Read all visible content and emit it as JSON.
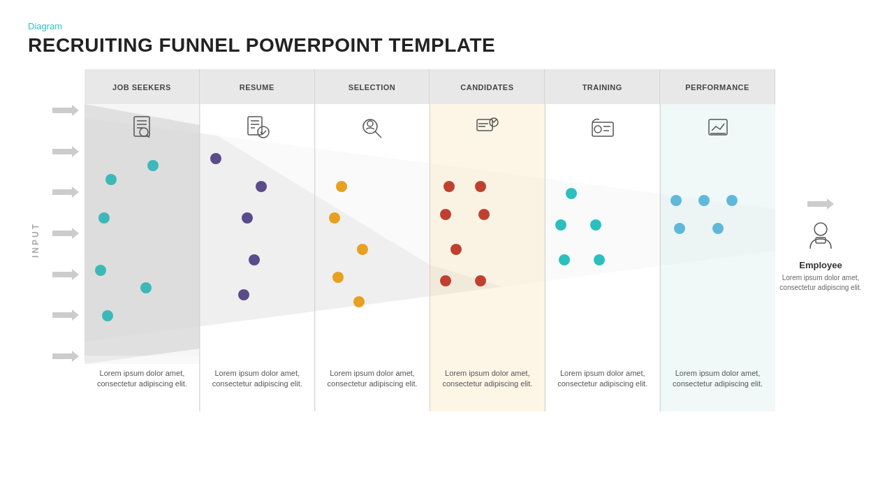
{
  "header": {
    "diagram_label": "Diagram",
    "title": "RECRUITING FUNNEL POWERPOINT TEMPLATE"
  },
  "input_label": "INPUT",
  "columns": [
    {
      "id": "job-seekers",
      "header": "JOB SEEKERS",
      "footer": "Lorem ipsum dolor amet, consectetur adipiscing elit.",
      "bg_color": "#e8e8e8",
      "body_bg": "#e0e0e0",
      "funnel_fill": "#d4d4d4"
    },
    {
      "id": "resume",
      "header": "RESUME",
      "footer": "Lorem ipsum dolor amet, consectetur adipiscing elit.",
      "bg_color": "#e8e8e8",
      "body_bg": "#e8e8e8",
      "funnel_fill": "#c8c8c8"
    },
    {
      "id": "selection",
      "header": "SELECTION",
      "footer": "Lorem ipsum dolor amet, consectetur adipiscing elit.",
      "bg_color": "#e8e8e8",
      "body_bg": "#e8e8e8",
      "funnel_fill": "#c0c0c0"
    },
    {
      "id": "candidates",
      "header": "CANDIDATES",
      "footer": "Lorem ipsum dolor amet, consectetur adipiscing elit.",
      "bg_color": "#e8e8e8",
      "body_bg": "#f5e8c0",
      "funnel_fill": "#f0d080"
    },
    {
      "id": "training",
      "header": "TRAINING",
      "footer": "Lorem ipsum dolor amet, consectetur adipiscing elit.",
      "bg_color": "#e8e8e8",
      "body_bg": "#e8e8e8",
      "funnel_fill": "#d0d0d0"
    },
    {
      "id": "performance",
      "header": "PERFORMANCE",
      "footer": "Lorem ipsum dolor amet, consectetur adipiscing elit.",
      "bg_color": "#e8e8e8",
      "body_bg": "#e8e8e8",
      "funnel_fill": "#c0d8d8"
    }
  ],
  "employee": {
    "label": "Employee",
    "description": "Lorem ipsum dolor amet, consectetur adipiscing elit."
  },
  "arrows": {
    "count": 7,
    "color": "#cccccc"
  }
}
